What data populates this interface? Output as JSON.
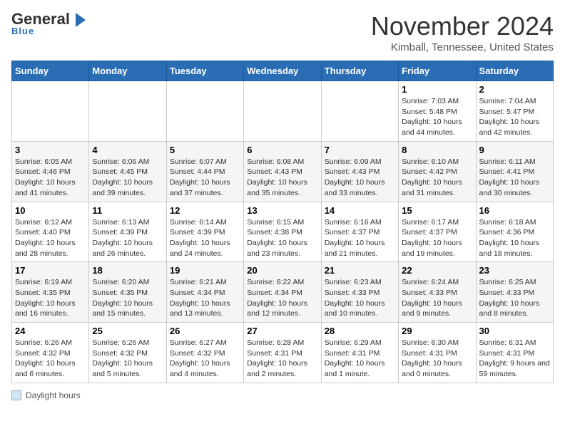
{
  "logo": {
    "line1": "General",
    "line2": "Blue",
    "arrow": "▶"
  },
  "title": "November 2024",
  "subtitle": "Kimball, Tennessee, United States",
  "days_of_week": [
    "Sunday",
    "Monday",
    "Tuesday",
    "Wednesday",
    "Thursday",
    "Friday",
    "Saturday"
  ],
  "legend_label": "Daylight hours",
  "weeks": [
    [
      {
        "day": "",
        "info": ""
      },
      {
        "day": "",
        "info": ""
      },
      {
        "day": "",
        "info": ""
      },
      {
        "day": "",
        "info": ""
      },
      {
        "day": "",
        "info": ""
      },
      {
        "day": "1",
        "info": "Sunrise: 7:03 AM\nSunset: 5:48 PM\nDaylight: 10 hours and 44 minutes."
      },
      {
        "day": "2",
        "info": "Sunrise: 7:04 AM\nSunset: 5:47 PM\nDaylight: 10 hours and 42 minutes."
      }
    ],
    [
      {
        "day": "3",
        "info": "Sunrise: 6:05 AM\nSunset: 4:46 PM\nDaylight: 10 hours and 41 minutes."
      },
      {
        "day": "4",
        "info": "Sunrise: 6:06 AM\nSunset: 4:45 PM\nDaylight: 10 hours and 39 minutes."
      },
      {
        "day": "5",
        "info": "Sunrise: 6:07 AM\nSunset: 4:44 PM\nDaylight: 10 hours and 37 minutes."
      },
      {
        "day": "6",
        "info": "Sunrise: 6:08 AM\nSunset: 4:43 PM\nDaylight: 10 hours and 35 minutes."
      },
      {
        "day": "7",
        "info": "Sunrise: 6:09 AM\nSunset: 4:43 PM\nDaylight: 10 hours and 33 minutes."
      },
      {
        "day": "8",
        "info": "Sunrise: 6:10 AM\nSunset: 4:42 PM\nDaylight: 10 hours and 31 minutes."
      },
      {
        "day": "9",
        "info": "Sunrise: 6:11 AM\nSunset: 4:41 PM\nDaylight: 10 hours and 30 minutes."
      }
    ],
    [
      {
        "day": "10",
        "info": "Sunrise: 6:12 AM\nSunset: 4:40 PM\nDaylight: 10 hours and 28 minutes."
      },
      {
        "day": "11",
        "info": "Sunrise: 6:13 AM\nSunset: 4:39 PM\nDaylight: 10 hours and 26 minutes."
      },
      {
        "day": "12",
        "info": "Sunrise: 6:14 AM\nSunset: 4:39 PM\nDaylight: 10 hours and 24 minutes."
      },
      {
        "day": "13",
        "info": "Sunrise: 6:15 AM\nSunset: 4:38 PM\nDaylight: 10 hours and 23 minutes."
      },
      {
        "day": "14",
        "info": "Sunrise: 6:16 AM\nSunset: 4:37 PM\nDaylight: 10 hours and 21 minutes."
      },
      {
        "day": "15",
        "info": "Sunrise: 6:17 AM\nSunset: 4:37 PM\nDaylight: 10 hours and 19 minutes."
      },
      {
        "day": "16",
        "info": "Sunrise: 6:18 AM\nSunset: 4:36 PM\nDaylight: 10 hours and 18 minutes."
      }
    ],
    [
      {
        "day": "17",
        "info": "Sunrise: 6:19 AM\nSunset: 4:35 PM\nDaylight: 10 hours and 16 minutes."
      },
      {
        "day": "18",
        "info": "Sunrise: 6:20 AM\nSunset: 4:35 PM\nDaylight: 10 hours and 15 minutes."
      },
      {
        "day": "19",
        "info": "Sunrise: 6:21 AM\nSunset: 4:34 PM\nDaylight: 10 hours and 13 minutes."
      },
      {
        "day": "20",
        "info": "Sunrise: 6:22 AM\nSunset: 4:34 PM\nDaylight: 10 hours and 12 minutes."
      },
      {
        "day": "21",
        "info": "Sunrise: 6:23 AM\nSunset: 4:33 PM\nDaylight: 10 hours and 10 minutes."
      },
      {
        "day": "22",
        "info": "Sunrise: 6:24 AM\nSunset: 4:33 PM\nDaylight: 10 hours and 9 minutes."
      },
      {
        "day": "23",
        "info": "Sunrise: 6:25 AM\nSunset: 4:33 PM\nDaylight: 10 hours and 8 minutes."
      }
    ],
    [
      {
        "day": "24",
        "info": "Sunrise: 6:26 AM\nSunset: 4:32 PM\nDaylight: 10 hours and 6 minutes."
      },
      {
        "day": "25",
        "info": "Sunrise: 6:26 AM\nSunset: 4:32 PM\nDaylight: 10 hours and 5 minutes."
      },
      {
        "day": "26",
        "info": "Sunrise: 6:27 AM\nSunset: 4:32 PM\nDaylight: 10 hours and 4 minutes."
      },
      {
        "day": "27",
        "info": "Sunrise: 6:28 AM\nSunset: 4:31 PM\nDaylight: 10 hours and 2 minutes."
      },
      {
        "day": "28",
        "info": "Sunrise: 6:29 AM\nSunset: 4:31 PM\nDaylight: 10 hours and 1 minute."
      },
      {
        "day": "29",
        "info": "Sunrise: 6:30 AM\nSunset: 4:31 PM\nDaylight: 10 hours and 0 minutes."
      },
      {
        "day": "30",
        "info": "Sunrise: 6:31 AM\nSunset: 4:31 PM\nDaylight: 9 hours and 59 minutes."
      }
    ]
  ]
}
